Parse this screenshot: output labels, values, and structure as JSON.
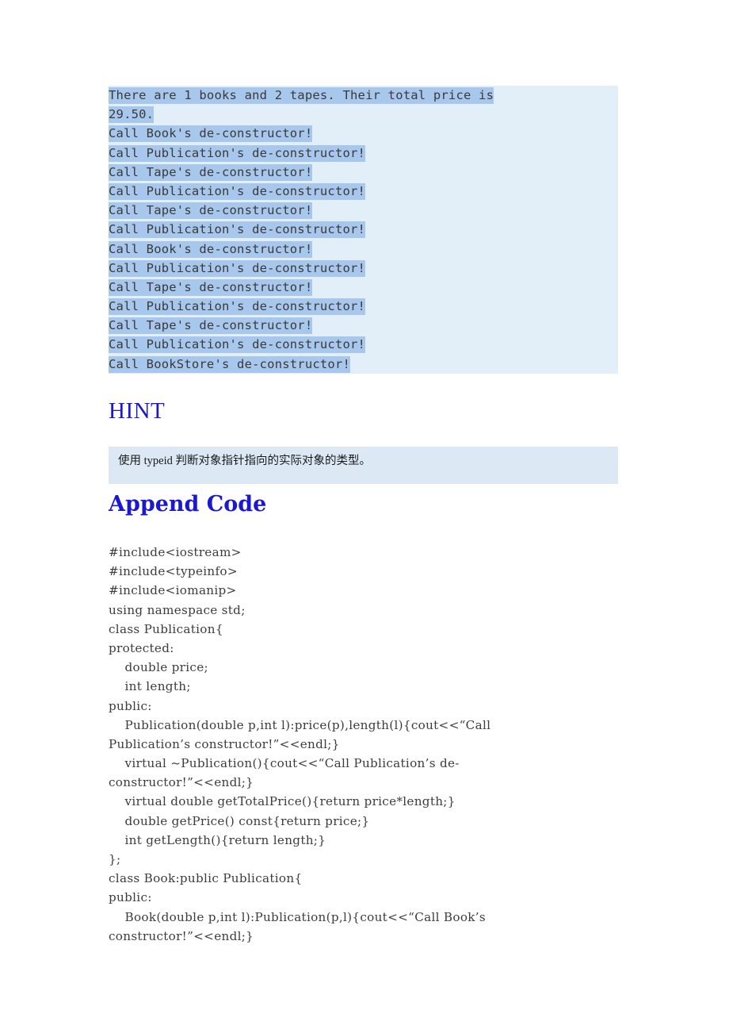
{
  "document": {
    "page_background": "#ffffff",
    "accent_heading_color": "#1c18d0",
    "output_block_bg": "#e2eef8",
    "selection_highlight": "#a8c7ec",
    "hint_box_bg": "#dce9f5"
  },
  "output_block": {
    "lines": [
      "There are 1 books and 2 tapes. Their total price is",
      "29.50.",
      "Call Book's de-constructor!",
      "Call Publication's de-constructor!",
      "Call Tape's de-constructor!",
      "Call Publication's de-constructor!",
      "Call Tape's de-constructor!",
      "Call Publication's de-constructor!",
      "Call Book's de-constructor!",
      "Call Publication's de-constructor!",
      "Call Tape's de-constructor!",
      "Call Publication's de-constructor!",
      "Call Tape's de-constructor!",
      "Call Publication's de-constructor!",
      "Call BookStore's de-constructor!"
    ]
  },
  "hint_section": {
    "heading": "HINT",
    "body": "使用 typeid 判断对象指针指向的实际对象的类型。"
  },
  "append_code_section": {
    "heading": "Append Code",
    "lines": [
      "#include<iostream>",
      "#include<typeinfo>",
      "#include<iomanip>",
      "using namespace std;",
      "class Publication{",
      "protected:",
      "    double price;",
      "    int length;",
      "public:",
      "    Publication(double p,int l):price(p),length(l){cout<<“Call",
      "Publication’s constructor!”<<endl;}",
      "    virtual ~Publication(){cout<<“Call Publication’s de-",
      "constructor!”<<endl;}",
      "    virtual double getTotalPrice(){return price*length;}",
      "    double getPrice() const{return price;}",
      "    int getLength(){return length;}",
      "};",
      "class Book:public Publication{",
      "public:",
      "    Book(double p,int l):Publication(p,l){cout<<“Call Book’s",
      "constructor!”<<endl;}"
    ]
  }
}
